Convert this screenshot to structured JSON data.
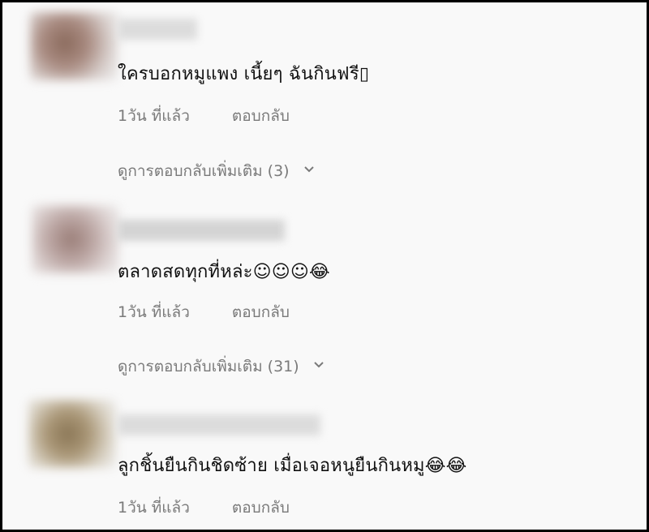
{
  "comments": [
    {
      "text": "ใครบอกหมูแพง เนี้ยๆ ฉันกินฟรี▯",
      "time": "1วัน ที่แล้ว",
      "reply": "ตอบกลับ",
      "more_replies": "ดูการตอบกลับเพิ่มเติม (3)"
    },
    {
      "text": "ตลาดสดทุกที่หล่ะ☺☺☺😂",
      "time": "1วัน ที่แล้ว",
      "reply": "ตอบกลับ",
      "more_replies": "ดูการตอบกลับเพิ่มเติม (31)"
    },
    {
      "text": "ลูกชิ้นยืนกินชิดซ้าย เมื่อเจอหนูยืนกินหมู😂😂",
      "time": "1วัน ที่แล้ว",
      "reply": "ตอบกลับ"
    }
  ],
  "icons": {
    "expand": "chevron-down-icon"
  },
  "colors": {
    "background": "#f9f9f9",
    "meta_text": "#7a7a7a",
    "body_text": "#111111"
  }
}
